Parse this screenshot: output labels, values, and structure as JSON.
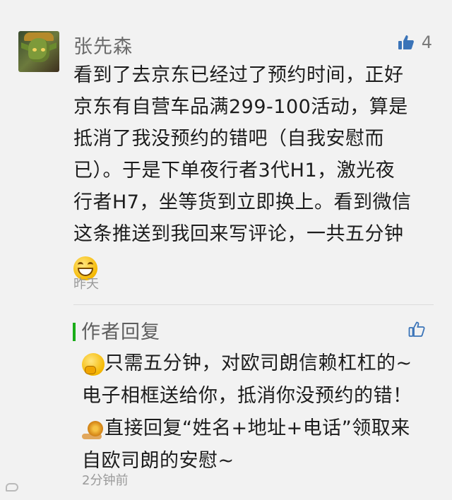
{
  "comment": {
    "username": "张先森",
    "like_count": "4",
    "content_lines": [
      "看到了去京东已经过了预约时间，正好",
      "京东有自营车品满299-100活动，算是",
      "抵消了我没预约的错吧（自我安慰而",
      "已）。于是下单夜行者3代H1，激光夜",
      "行者H7，坐等货到立即换上。看到微信",
      "这条推送到我回来写评论，一共五分钟"
    ],
    "timestamp": "昨天"
  },
  "reply": {
    "title": "作者回复",
    "lines": [
      "只需五分钟，对欧司朗信赖杠杠的~",
      "电子相框送给你，抵消你没预约的错！",
      "直接回复“姓名+地址+电话”领取来",
      "自欧司朗的安慰~"
    ],
    "timestamp": "2分钟前"
  },
  "icons": {
    "like": "thumbs-up-icon",
    "grin": "grinning-emoji-icon",
    "thinking": "thinking-emoji-icon",
    "snail": "snail-emoji-icon"
  },
  "colors": {
    "accent": "#1aad19",
    "like_icon": "#3b74b8",
    "muted_text": "#9a9a9a"
  }
}
